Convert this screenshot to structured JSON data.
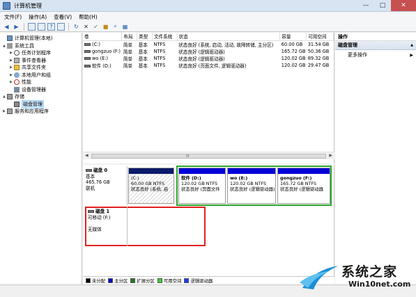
{
  "window": {
    "title": "计算机管理",
    "min": "—",
    "max": "□",
    "close": "✕"
  },
  "menu": [
    "文件(F)",
    "操作(A)",
    "查看(V)",
    "帮助(H)"
  ],
  "tree": [
    {
      "label": "计算机管理(本地)",
      "icon": "computer-icon",
      "twisty": "",
      "indent": 0
    },
    {
      "label": "系统工具",
      "icon": "tools-icon",
      "twisty": "▲",
      "indent": 1
    },
    {
      "label": "任务计划程序",
      "icon": "clock-icon",
      "twisty": "▶",
      "indent": 2
    },
    {
      "label": "事件查看器",
      "icon": "event-viewer-icon",
      "twisty": "▶",
      "indent": 2
    },
    {
      "label": "共享文件夹",
      "icon": "shared-folder-icon",
      "twisty": "▶",
      "indent": 2
    },
    {
      "label": "本地用户和组",
      "icon": "users-icon",
      "twisty": "▶",
      "indent": 2
    },
    {
      "label": "性能",
      "icon": "performance-icon",
      "twisty": "▶",
      "indent": 2
    },
    {
      "label": "设备管理器",
      "icon": "device-manager-icon",
      "twisty": "",
      "indent": 2
    },
    {
      "label": "存储",
      "icon": "storage-icon",
      "twisty": "▲",
      "indent": 1
    },
    {
      "label": "磁盘管理",
      "icon": "disk-management-icon",
      "twisty": "",
      "indent": 2,
      "selected": true
    },
    {
      "label": "服务和应用程序",
      "icon": "services-icon",
      "twisty": "▶",
      "indent": 1
    }
  ],
  "volumes": {
    "headers": [
      "卷",
      "布局",
      "类型",
      "文件系统",
      "状态",
      "容量",
      "可用空间"
    ],
    "rows": [
      [
        "(C:)",
        "简单",
        "基本",
        "NTFS",
        "状态良好 (系统, 启动, 活动, 故障转储, 主分区)",
        "60.00 GB",
        "31.54 GB"
      ],
      [
        "gongzuo (F:)",
        "简单",
        "基本",
        "NTFS",
        "状态良好 (逻辑驱动器)",
        "165.72 GB",
        "50.36 GB"
      ],
      [
        "wo (E:)",
        "简单",
        "基本",
        "NTFS",
        "状态良好 (逻辑驱动器)",
        "120.02 GB",
        "89.32 GB"
      ],
      [
        "软件 (D:)",
        "简单",
        "基本",
        "NTFS",
        "状态良好 (页面文件, 逻辑驱动器)",
        "120.02 GB",
        "29.47 GB"
      ]
    ],
    "scroll_grip": "III",
    "scroll_left": "◀",
    "scroll_right": "▶"
  },
  "disk0": {
    "name": "磁盘 0",
    "type": "基本",
    "size": "465.76 GB",
    "status": "联机",
    "partitions": [
      {
        "name": "(C:)",
        "size": "60.00 GB NTFS",
        "status": "状态良好 (系统, 启"
      },
      {
        "name": "软件 (D:)",
        "size": "120.02 GB NTFS",
        "status": "状态良好 (页面文件"
      },
      {
        "name": "wo (E:)",
        "size": "120.02 GB NTFS",
        "status": "状态良好 (逻辑驱动器)"
      },
      {
        "name": "gongzuo (F:)",
        "size": "165.72 GB NTFS",
        "status": "状态良好 (逻辑驱动器"
      }
    ]
  },
  "disk1": {
    "name": "磁盘 1",
    "type": "可移动 (F:)",
    "status": "无媒体"
  },
  "legend": [
    {
      "label": "未分配",
      "color": "#000000"
    },
    {
      "label": "主分区",
      "color": "#0000d8"
    },
    {
      "label": "扩展分区",
      "color": "#1f7a1f"
    },
    {
      "label": "可用空间",
      "color": "#39d139"
    },
    {
      "label": "逻辑驱动器",
      "color": "#1a3cff"
    }
  ],
  "actions": {
    "header": "操作",
    "section": "磁盘管理",
    "section_arrow": "▲",
    "more": "更多操作",
    "more_arrow": "▶"
  },
  "watermark": {
    "title": "系统之家",
    "url": "Win10net.com"
  }
}
